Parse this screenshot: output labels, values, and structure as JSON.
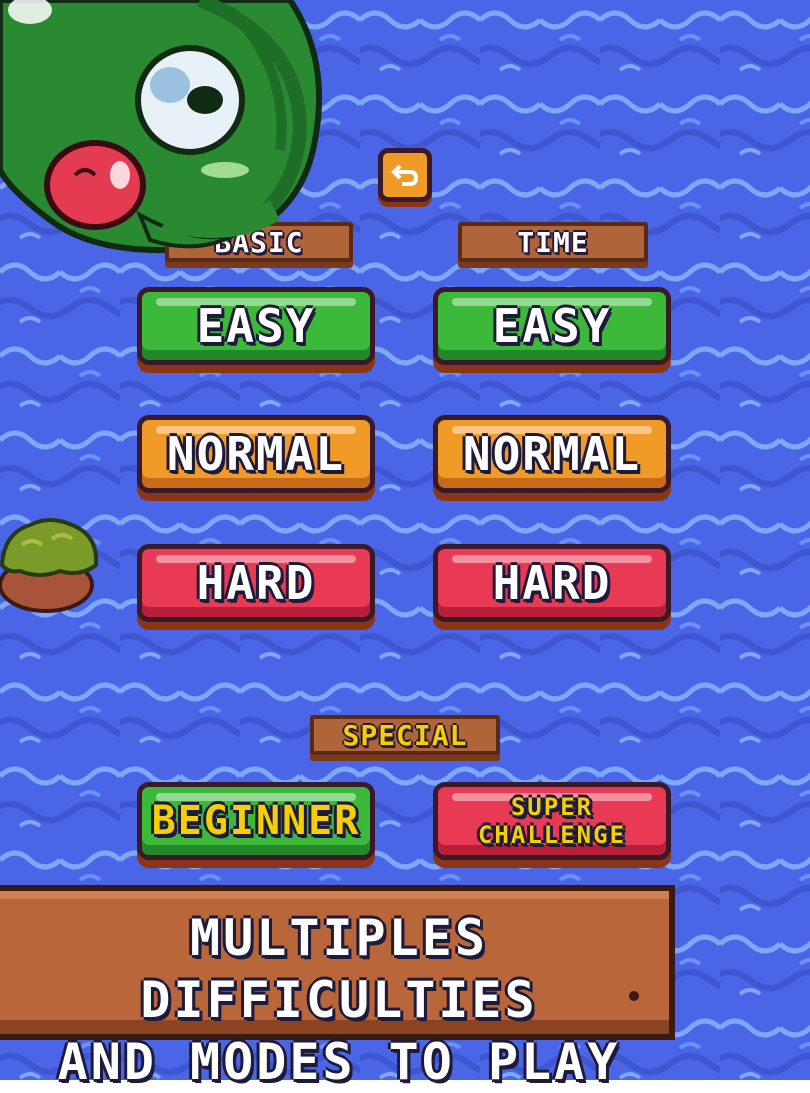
{
  "colors": {
    "water": "#4a66e6",
    "water_light": "#7ea8ff",
    "green_button": "#3cb83a",
    "orange_button": "#f09a28",
    "red_button": "#e83a54",
    "wood": "#b0643a",
    "special_text": "#f4d000"
  },
  "back_button": {
    "icon": "back-arrow-icon"
  },
  "columns": [
    {
      "header": "BASIC",
      "buttons": [
        {
          "label": "EASY",
          "color": "green"
        },
        {
          "label": "NORMAL",
          "color": "orange"
        },
        {
          "label": "HARD",
          "color": "red"
        }
      ]
    },
    {
      "header": "TIME",
      "buttons": [
        {
          "label": "EASY",
          "color": "green"
        },
        {
          "label": "NORMAL",
          "color": "orange"
        },
        {
          "label": "HARD",
          "color": "red"
        }
      ]
    }
  ],
  "special": {
    "header": "SPECIAL",
    "buttons": [
      {
        "label": "BEGINNER",
        "color": "green"
      },
      {
        "label": "SUPER\nCHALLENGE",
        "color": "red"
      }
    ]
  },
  "banner": {
    "line1": "MULTIPLES DIFFICULTIES",
    "line2": "AND MODES TO PLAY"
  },
  "decor": [
    "frog-character-icon",
    "bush-island-icon"
  ]
}
